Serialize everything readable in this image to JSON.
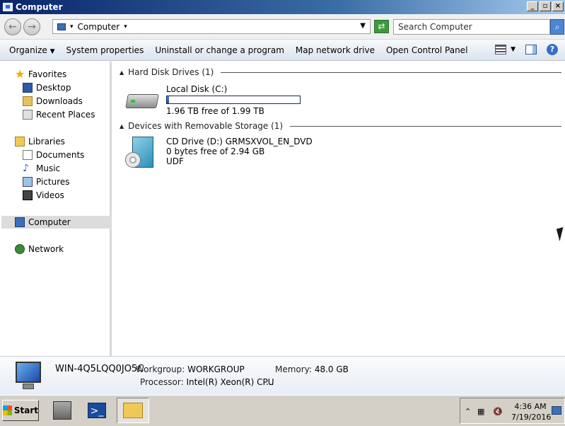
{
  "window": {
    "title": "Computer"
  },
  "address": {
    "crumb": "Computer",
    "search_placeholder": "Search Computer"
  },
  "toolbar": {
    "organize": "Organize",
    "system_properties": "System properties",
    "uninstall": "Uninstall or change a program",
    "map_drive": "Map network drive",
    "control_panel": "Open Control Panel"
  },
  "nav": {
    "favorites": "Favorites",
    "desktop": "Desktop",
    "downloads": "Downloads",
    "recent": "Recent Places",
    "libraries": "Libraries",
    "documents": "Documents",
    "music": "Music",
    "pictures": "Pictures",
    "videos": "Videos",
    "computer": "Computer",
    "network": "Network"
  },
  "groups": {
    "hdd": {
      "header": "Hard Disk Drives (1)",
      "drive_name": "Local Disk (C:)",
      "drive_free": "1.96 TB free of 1.99 TB",
      "used_fraction": 0.015
    },
    "removable": {
      "header": "Devices with Removable Storage (1)",
      "drive_name": "CD Drive (D:) GRMSXVOL_EN_DVD",
      "drive_free": "0 bytes free of 2.94 GB",
      "filesystem": "UDF"
    }
  },
  "details": {
    "computer_name": "WIN-4Q5LQQ0JO5C",
    "workgroup_label": "Workgroup:",
    "workgroup": "WORKGROUP",
    "memory_label": "Memory:",
    "memory": "48.0 GB",
    "processor_label": "Processor:",
    "processor": "Intel(R) Xeon(R) CPU",
    "more": "..."
  },
  "taskbar": {
    "start": "Start",
    "time": "4:36 AM",
    "date": "7/19/2016"
  }
}
